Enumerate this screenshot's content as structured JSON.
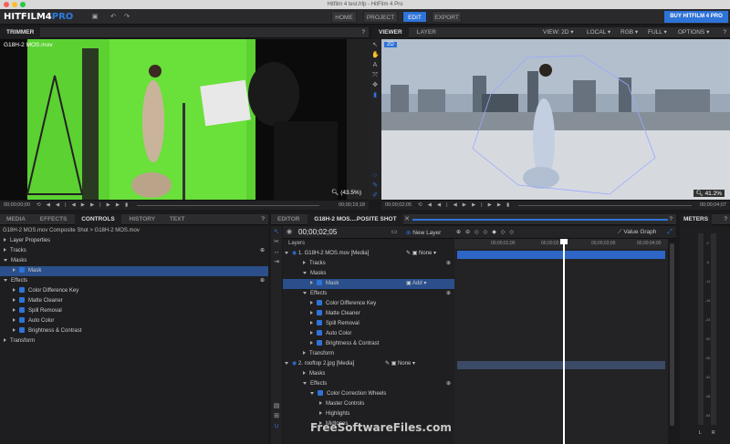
{
  "window": {
    "title": "Hitfilm 4 test.hfp - HitFilm 4 Pro"
  },
  "app": {
    "logo_main": "HITFILM4",
    "logo_accent": "PRO"
  },
  "nav": {
    "home": "HOME",
    "project": "PROJECT",
    "edit": "EDIT",
    "export": "EXPORT",
    "buy": "BUY HITFILM 4 PRO"
  },
  "trimmer": {
    "tab": "TRIMMER",
    "clip_name": "G18H-2 MOS.mov",
    "zoom": "(43.5%)",
    "timecode_start": "00;00;00;00",
    "timecode_end": "00;00;19;18"
  },
  "viewer": {
    "tab_viewer": "VIEWER",
    "tab_layer": "LAYER",
    "badge_2d": "2D",
    "view_mode": "VIEW: 2D",
    "space": "LOCAL",
    "channels": "RGB",
    "resolution": "FULL",
    "options": "OPTIONS",
    "zoom": "41.2%",
    "timecode_start": "00;00;02;05",
    "timecode_end": "00;00;04;07"
  },
  "left_panel": {
    "tabs": [
      "MEDIA",
      "EFFECTS",
      "CONTROLS",
      "HISTORY",
      "TEXT"
    ],
    "active_tab": "CONTROLS",
    "breadcrumb": "G18H-2 MOS.mov Composite Shot > G18H-2 MOS.mov",
    "items": {
      "layer_properties": "Layer Properties",
      "tracks": "Tracks",
      "masks": "Masks",
      "mask": "Mask",
      "effects": "Effects",
      "effect1": "Color Difference Key",
      "effect2": "Matte Cleaner",
      "effect3": "Spill Removal",
      "effect4": "Auto Color",
      "effect5": "Brightness & Contrast",
      "transform": "Transform"
    }
  },
  "editor": {
    "tab_editor": "EDITOR",
    "tab_comp": "G18H-2 MOS....POSITE SHOT",
    "timecode": "00;00;02;05",
    "new_layer": "New Layer",
    "value_graph": "Value Graph",
    "layers_label": "Layers",
    "ruler": [
      "00;00;01;00",
      "00;00;02;00",
      "00;00;03;00",
      "00;00;04;00"
    ],
    "layer1": "1. G18H-2 MOS.mov [Media]",
    "layer1_blend": "None",
    "tracks": "Tracks",
    "masks": "Masks",
    "mask": "Mask",
    "mask_mode": "Add",
    "effects": "Effects",
    "e1": "Color Difference Key",
    "e2": "Matte Cleaner",
    "e3": "Spill Removal",
    "e4": "Auto Color",
    "e5": "Brightness & Contrast",
    "transform": "Transform",
    "layer2": "2. rooftop 2.jpg [Media]",
    "layer2_blend": "None",
    "l2_masks": "Masks",
    "l2_effects": "Effects",
    "ccw": "Color Correction Wheels",
    "master": "Master Controls",
    "highlights": "Highlights",
    "midtones": "Midtones"
  },
  "meters": {
    "title": "METERS",
    "left": "L",
    "right": "R",
    "scale": [
      "0",
      "-6",
      "-12",
      "-18",
      "-24",
      "-30",
      "-36",
      "-42",
      "-48",
      "-54"
    ]
  },
  "watermark": "FreeSoftwareFiles.com",
  "colors": {
    "accent": "#2e73d8",
    "green_screen": "#5cd132",
    "sky": "#9aa8b8"
  }
}
